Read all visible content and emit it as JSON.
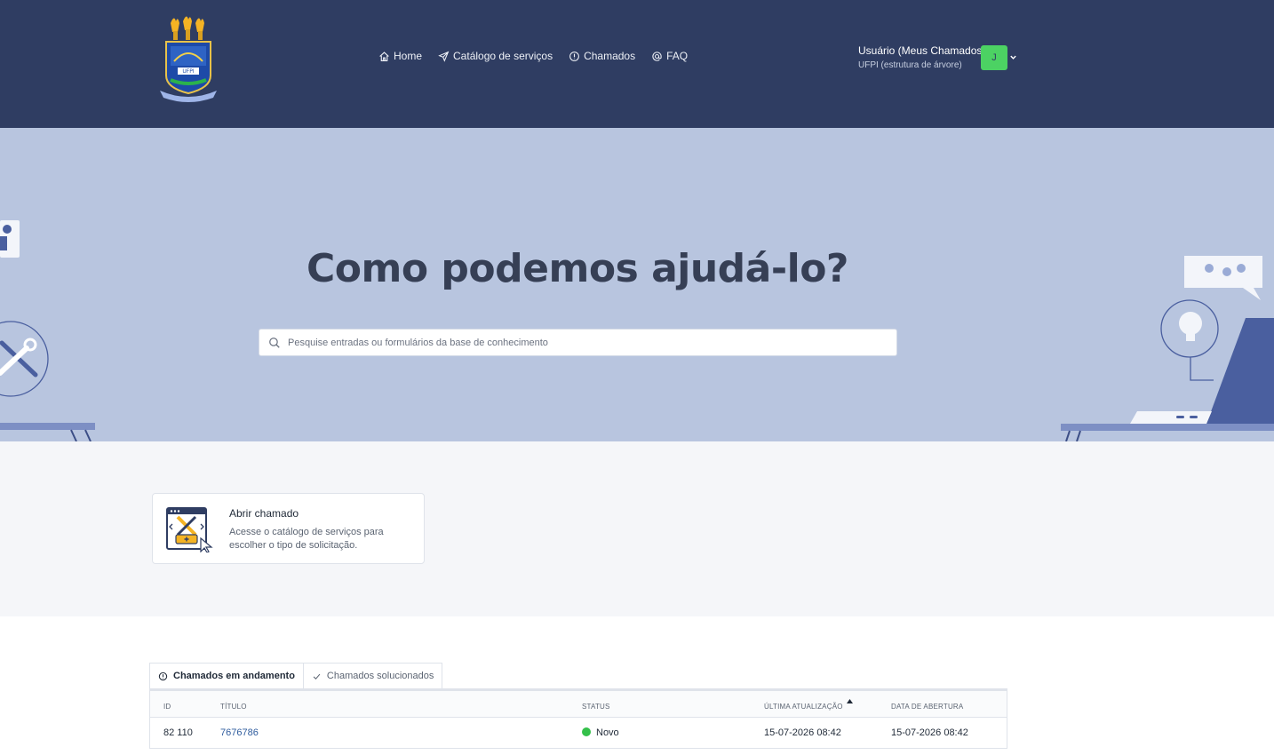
{
  "header": {
    "nav": [
      {
        "label": "Home",
        "icon": "home-icon"
      },
      {
        "label": "Catálogo de serviços",
        "icon": "paper-plane-icon"
      },
      {
        "label": "Chamados",
        "icon": "alert-circle-icon"
      },
      {
        "label": "FAQ",
        "icon": "at-icon"
      }
    ],
    "user": {
      "name": "Usuário (Meus Chamados)",
      "entity": "UFPI (estrutura de árvore)",
      "avatar_initial": "J",
      "avatar_color": "#4cd263"
    },
    "colors": {
      "background": "#2f3d62"
    }
  },
  "hero": {
    "title": "Como podemos ajudá-lo?",
    "search_placeholder": "Pesquise entradas ou formulários da base de conhecimento",
    "colors": {
      "background": "#b8c5df"
    }
  },
  "tiles": [
    {
      "title": "Abrir chamado",
      "description": "Acesse o catálogo de serviços para escolher o tipo de solicitação."
    }
  ],
  "tickets": {
    "tabs": [
      {
        "label": "Chamados em andamento",
        "icon": "alert-circle-icon",
        "active": true
      },
      {
        "label": "Chamados solucionados",
        "icon": "check-icon",
        "active": false
      }
    ],
    "columns": [
      "ID",
      "Título",
      "Status",
      "Última atualização",
      "Data de abertura"
    ],
    "sorted_column": "Última atualização",
    "rows": [
      {
        "id": "82 110",
        "title": "7676786",
        "status": "Novo",
        "status_color": "#34c04a",
        "updated": "15-07-2026 08:42",
        "opened": "15-07-2026 08:42"
      }
    ]
  }
}
